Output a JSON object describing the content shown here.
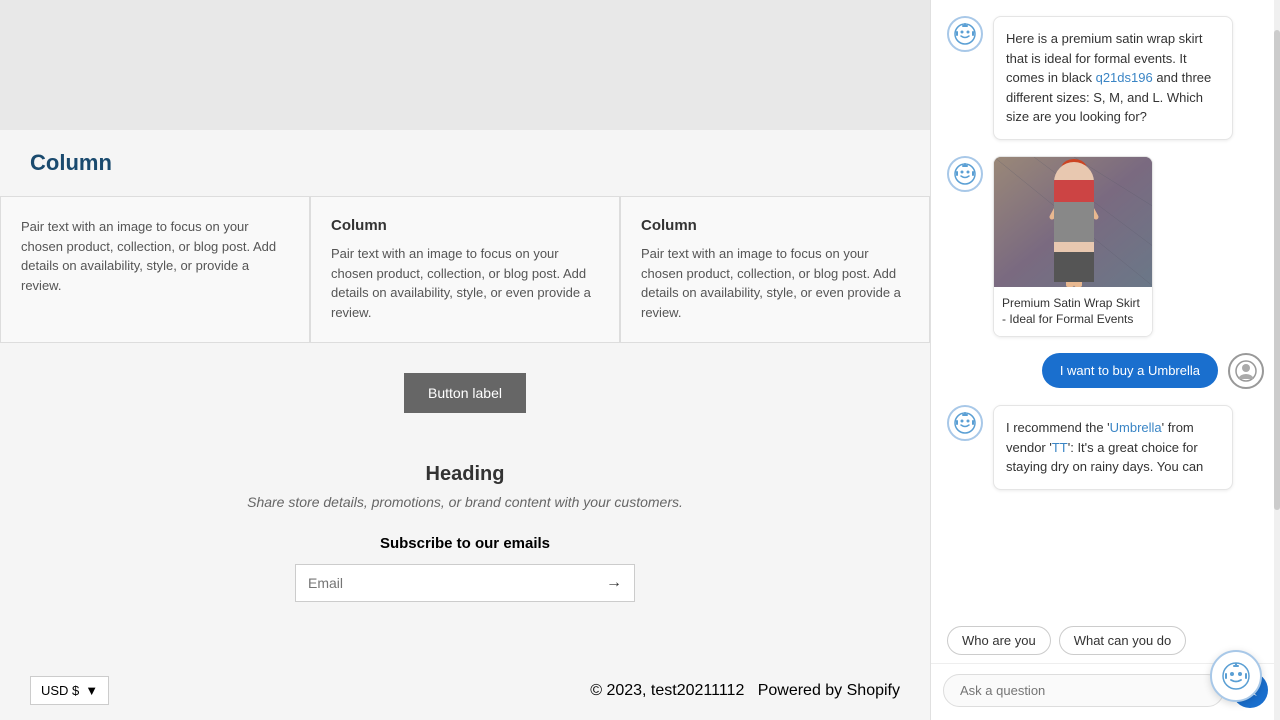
{
  "page": {
    "background_color": "#f5f5f5"
  },
  "main": {
    "section_heading": "Column",
    "columns": [
      {
        "title": "",
        "body": "Pair text with an image to focus on your chosen product, collection, or blog post. Add details on availability, style, or provide a review."
      },
      {
        "title": "Column",
        "body": "Pair text with an image to focus on your chosen product, collection, or blog post. Add details on availability, style, or even provide a review."
      },
      {
        "title": "Column",
        "body": "Pair text with an image to focus on your chosen product, collection, or blog post. Add details on availability, style, or even provide a review."
      }
    ],
    "button_label": "Button label",
    "heading": "Heading",
    "heading_sub": "Share store details, promotions, or brand content with your customers.",
    "subscribe_title": "Subscribe to our emails",
    "email_placeholder": "Email",
    "footer": {
      "currency": "USD $",
      "copyright": "© 2023, test20211112",
      "powered": "Powered by Shopify"
    }
  },
  "chat": {
    "messages": [
      {
        "type": "bot",
        "text_parts": [
          {
            "text": "Here is a premium satin wrap skirt that is ideal for formal events. It comes in black ",
            "highlight": false
          },
          {
            "text": "q21ds196",
            "highlight": true
          },
          {
            "text": " and three different sizes: S, M, and L. Which size are you looking for?",
            "highlight": false
          }
        ]
      },
      {
        "type": "bot-product",
        "product_name": "Premium Satin Wrap Skirt - Ideal for Formal Events"
      },
      {
        "type": "user",
        "text": "I want to buy a Umbrella"
      },
      {
        "type": "bot-partial",
        "text_parts": [
          {
            "text": "I recommend the '",
            "highlight": false
          },
          {
            "text": "Umbrella",
            "highlight": true
          },
          {
            "text": "' from vendor '",
            "highlight": false
          },
          {
            "text": "TT",
            "highlight": true
          },
          {
            "text": "': It's a great choice for staying dry on rainy days. You can",
            "highlight": false
          }
        ]
      }
    ],
    "suggestions": [
      {
        "label": "Who are you"
      },
      {
        "label": "What can you do"
      }
    ],
    "input_placeholder": "Ask a question",
    "send_label": "Send"
  }
}
